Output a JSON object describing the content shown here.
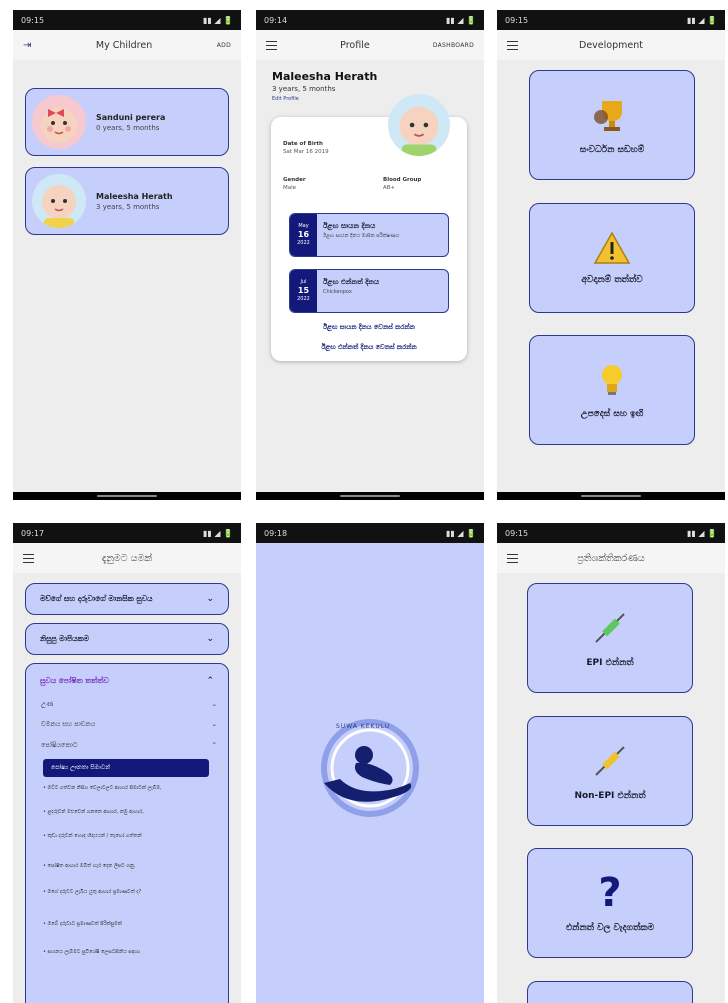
{
  "screens": [
    {
      "status_time": "09:15",
      "appbar": {
        "title": "My Children",
        "action": "ADD"
      },
      "children": [
        {
          "name": "Sanduni perera",
          "age": "0 years, 5 months"
        },
        {
          "name": "Maleesha Herath",
          "age": "3 years, 5 months"
        }
      ]
    },
    {
      "status_time": "09:14",
      "appbar": {
        "title": "Profile",
        "action": "DASHBOARD"
      },
      "profile": {
        "name": "Maleesha Herath",
        "age": "3 years, 5 months",
        "edit": "Edit Profile",
        "dob_label": "Date of Birth",
        "dob_value": "Sat Mar 16 2019",
        "gender_label": "Gender",
        "gender_value": "Male",
        "blood_label": "Blood Group",
        "blood_value": "AB+",
        "events": [
          {
            "month": "May",
            "day": "16",
            "year": "2022",
            "title": "ඊළඟ සායන දිනය",
            "sub": "ඊළඟ සායන දිනය මාසික පරීක්ෂණය"
          },
          {
            "month": "Jul",
            "day": "15",
            "year": "2022",
            "title": "ඊළඟ එන්නත් දිනය",
            "sub": "Chickenpox"
          }
        ],
        "link1": "ඊළඟ සායන දිනය වෙනස් කරන්න",
        "link2": "ඊළඟ එන්නත් දිනය වෙනස් කරන්න"
      }
    },
    {
      "status_time": "09:15",
      "appbar": {
        "title": "Development"
      },
      "tiles": [
        {
          "label": "සංවර්ධන සඩහම්",
          "icon": "trophy-icon"
        },
        {
          "label": "අවදානම් තත්ත්ව",
          "icon": "warning-icon"
        },
        {
          "label": "උපදෙස් සහ ඉඟි",
          "icon": "bulb-icon"
        }
      ]
    },
    {
      "status_time": "09:17",
      "appbar": {
        "title": "දැනුමට යමක්"
      },
      "sections": [
        {
          "label": "මව්ගේ සහ දරුවාගේ මානසික සුවය"
        },
        {
          "label": "නිසුපු මාපියකම"
        },
        {
          "label": "සුවය පෝෂිත තත්ත්ව"
        }
      ],
      "subitems": [
        "උණ",
        "වමනය සහ පාචනය",
        "පෝෂියකොට"
      ],
      "highlight": "පෝෂ්‍ය ඌනතා සිමාවන්",
      "tips": [
        "• මව්ට ගත්වන නිසිග වෙලාවලට ආහාර සීමාවක් ලැබීම,",
        "• ළදරුවන් ඔළුවෙන් ගනනෙ ආහාර, නමු ආහාර,",
        "• කුඩා දරුවන් හොඳ හිඳයයන් / තැහෝ ගත්තන්",
        "• පෝෂිත ආහාර ඔබිත් හැර දෙන ලිපට ගනු,",
        "• මගේ දරුවට ලැබිය යුතු ආහාර ප්‍රමාණවත් ද?",
        "• ඔබේ දරුවාට ප්‍රමාණවත් පිරික්සුමක්",
        "• සහනය ලැබීමට සුවිශේෂී ලෙසටසිනිය සඳහා"
      ]
    },
    {
      "status_time": "09:18",
      "splash": {
        "logo_text": "SUWA KEKULU"
      }
    },
    {
      "status_time": "09:15",
      "appbar": {
        "title": "ප්‍රතිශක්තිකරණය"
      },
      "tiles": [
        {
          "label": "EPI එන්නත්",
          "icon": "syringe-green-icon"
        },
        {
          "label": "Non-EPI එන්නත්",
          "icon": "syringe-yellow-icon"
        },
        {
          "label": "එන්නත් වල වැදගත්කම",
          "icon": "question-icon"
        }
      ]
    }
  ],
  "colors": {
    "card": "#c6cffb",
    "border": "#2d3a8c",
    "dark": "#13197a",
    "accent_purple": "#7b2fbe"
  }
}
